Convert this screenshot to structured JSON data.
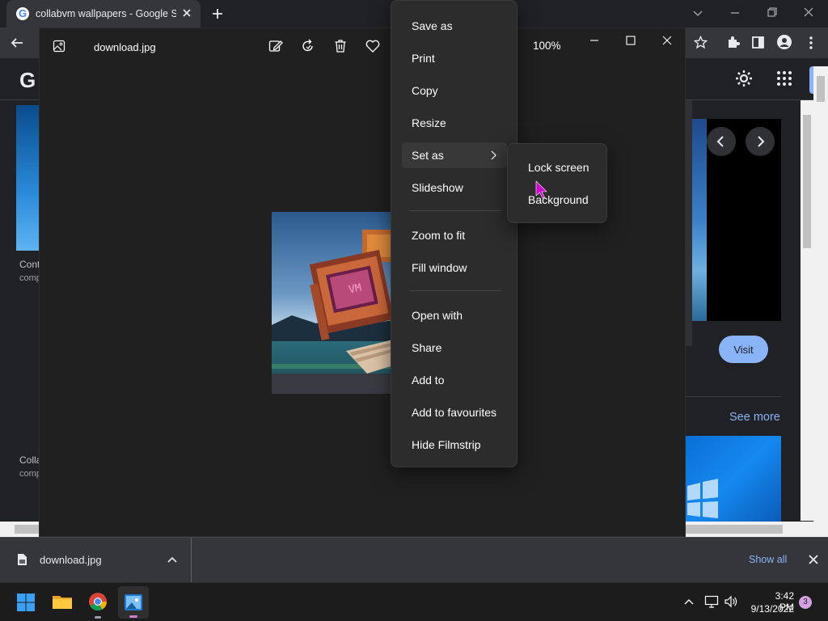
{
  "browser": {
    "tab_title": "collabvm wallpapers - Google Se",
    "left_results": [
      {
        "title": "Cont",
        "source": "comp"
      },
      {
        "title": "Colla",
        "source": "comp"
      }
    ],
    "visit_label": "Visit",
    "see_more_label": "See more"
  },
  "photos": {
    "filename": "download.jpg",
    "zoom": "100%"
  },
  "context_menu": {
    "items": [
      {
        "label": "Save as"
      },
      {
        "label": "Print"
      },
      {
        "label": "Copy"
      },
      {
        "label": "Resize"
      },
      {
        "label": "Set as"
      },
      {
        "label": "Slideshow"
      },
      {
        "label": "Zoom to fit"
      },
      {
        "label": "Fill window"
      },
      {
        "label": "Open with"
      },
      {
        "label": "Share"
      },
      {
        "label": "Add to"
      },
      {
        "label": "Add to favourites"
      },
      {
        "label": "Hide Filmstrip"
      }
    ],
    "submenu": [
      {
        "label": "Lock screen"
      },
      {
        "label": "Background"
      }
    ]
  },
  "downloads": {
    "filename": "download.jpg",
    "show_all_label": "Show all"
  },
  "taskbar": {
    "time": "3:42 PM",
    "date": "9/13/2022",
    "notification_count": "3"
  },
  "colors": {
    "accent_blue": "#8ab4f8",
    "menu_bg": "#2c2c2c",
    "cursor_magenta": "#d400d4"
  }
}
